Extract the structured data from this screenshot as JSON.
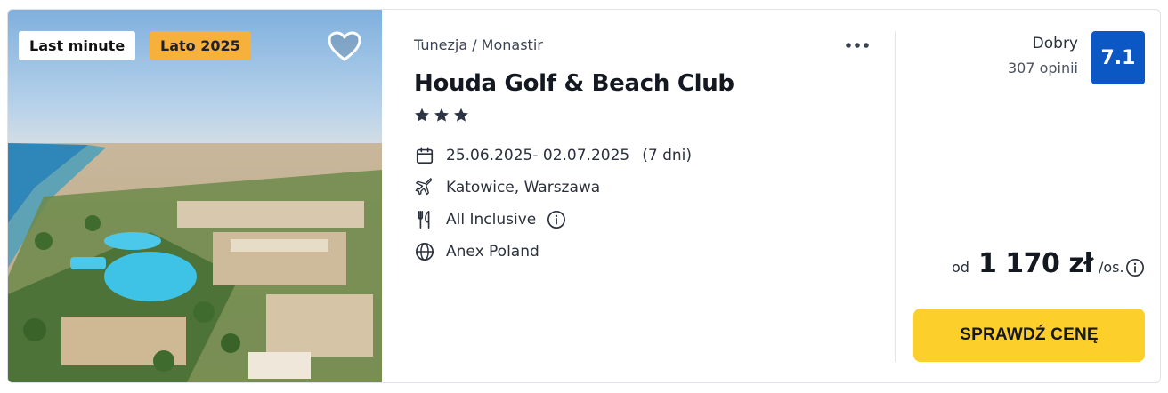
{
  "badges": {
    "last_minute": "Last minute",
    "season": "Lato 2025"
  },
  "offer": {
    "location": "Tunezja / Monastir",
    "hotel_name": "Houda Golf & Beach Club",
    "stars": 3,
    "dates": "25.06.2025- 02.07.2025",
    "duration": "(7 dni)",
    "departure": "Katowice, Warszawa",
    "board": "All Inclusive",
    "organizer": "Anex Poland"
  },
  "rating": {
    "label": "Dobry",
    "reviews": "307 opinii",
    "score": "7.1"
  },
  "price": {
    "prefix": "od",
    "amount": "1 170 zł",
    "suffix": "/os."
  },
  "cta": {
    "label": "SPRAWDŹ CENĘ"
  },
  "colors": {
    "accent_yellow": "#fdcf2a",
    "score_blue": "#0b57c4",
    "season_badge": "#f6b13d"
  },
  "icons": [
    "heart-icon",
    "more-dots-icon",
    "star-icon",
    "calendar-icon",
    "plane-icon",
    "cutlery-icon",
    "info-icon",
    "globe-icon"
  ]
}
